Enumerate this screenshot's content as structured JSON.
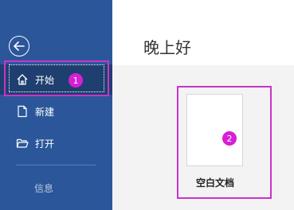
{
  "sidebar": {
    "items": [
      {
        "label": "开始",
        "icon": "home-icon"
      },
      {
        "label": "新建",
        "icon": "new-document-icon"
      },
      {
        "label": "打开",
        "icon": "open-folder-icon"
      }
    ],
    "info_label": "信息"
  },
  "main": {
    "greeting": "晚上好",
    "blank_document_label": "空白文档"
  },
  "annotations": {
    "badge1": "1",
    "badge2": "2"
  },
  "colors": {
    "sidebar_bg": "#2b579a",
    "active_item_bg": "#1e3f70",
    "highlight": "#cc33cc",
    "badge": "#d61fd6"
  }
}
